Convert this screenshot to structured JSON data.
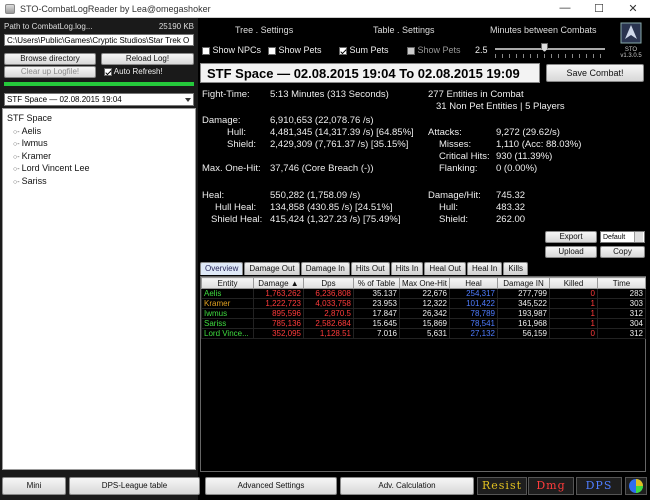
{
  "window": {
    "title": "STO-CombatLogReader by Lea@omegashoker",
    "min": "—",
    "max": "☐",
    "close": "✕"
  },
  "left": {
    "path_label": "Path to CombatLog.log...",
    "size": "25190 KB",
    "path_value": "C:\\Users\\Public\\Games\\Cryptic Studios\\Star Trek O",
    "browse": "Browse directory",
    "reload": "Reload Log!",
    "clear": "Clear up Logfile!",
    "auto_refresh": "Auto Refresh!",
    "combat_select": "STF Space — 02.08.2015 19:04",
    "tree": {
      "root": "STF Space",
      "children": [
        "Aelis",
        "Iwmus",
        "Kramer",
        "Lord Vincent Lee",
        "Sariss"
      ]
    }
  },
  "header": {
    "tree_settings": "Tree . Settings",
    "table_settings": "Table . Settings",
    "minutes": "Minutes between Combats",
    "show_npcs": "Show NPCs",
    "show_pets_tree": "Show Pets",
    "sum_pets": "Sum Pets",
    "show_pets_table": "Show Pets",
    "minutes_value": "2.5",
    "logo_text": "STO",
    "version": "v1.3.0.5"
  },
  "combat": {
    "title": "STF Space — 02.08.2015 19:04 To 02.08.2015 19:09",
    "save": "Save Combat!",
    "fight_time_label": "Fight-Time:",
    "fight_time": "5:13 Minutes (313 Seconds)",
    "entities": "277 Entities in Combat",
    "entities_sub": "31 Non Pet Entities | 5 Players",
    "damage_label": "Damage:",
    "damage": "6,910,653 (22,078.76 /s)",
    "hull_label": "Hull:",
    "hull": "4,481,345 (14,317.39 /s) [64.85%]",
    "shield_label": "Shield:",
    "shield": "2,429,309 (7,761.37 /s) [35.15%]",
    "attacks_label": "Attacks:",
    "attacks": "9,272 (29.62/s)",
    "misses_label": "Misses:",
    "misses": "1,110 (Acc: 88.03%)",
    "crits_label": "Critical Hits:",
    "crits": "930 (11.39%)",
    "flanking_label": "Flanking:",
    "flanking": "0 (0.00%)",
    "maxhit_label": "Max. One-Hit:",
    "maxhit": "37,746 (Core Breach (-))",
    "heal_label": "Heal:",
    "heal": "550,282 (1,758.09 /s)",
    "hullheal_label": "Hull Heal:",
    "hullheal": "134,858 (430.85 /s) [24.51%]",
    "shieldheal_label": "Shield Heal:",
    "shieldheal": "415,424 (1,327.23 /s) [75.49%]",
    "dmghit_label": "Damage/Hit:",
    "dmghit": "745.32",
    "dmghit_hull_label": "Hull:",
    "dmghit_hull": "483.32",
    "dmghit_shield_label": "Shield:",
    "dmghit_shield": "262.00",
    "export": "Export",
    "export_format": "Default",
    "upload": "Upload",
    "copy": "Copy"
  },
  "tabs": [
    "Overview",
    "Damage Out",
    "Damage In",
    "Hits Out",
    "Hits In",
    "Heal Out",
    "Heal In",
    "Kills"
  ],
  "table": {
    "columns": [
      "Entity",
      "Damage ▲",
      "Dps",
      "% of Table",
      "Max One-Hit",
      "Heal",
      "Damage IN",
      "Killed",
      "Time"
    ],
    "rows": [
      {
        "color": "#3fdc3f",
        "cells": [
          "Aelis",
          "1,763,262",
          "6,236,808",
          "35.137",
          "22,676",
          "254,317",
          "277,799",
          "0",
          "283"
        ]
      },
      {
        "color": "#e0a020",
        "cells": [
          "Kramer",
          "1,222,723",
          "4,033,758",
          "23.953",
          "12,322",
          "101,422",
          "345,522",
          "1",
          "303"
        ]
      },
      {
        "color": "#3fdc3f",
        "cells": [
          "Iwmus",
          "895,596",
          "2,870.5",
          "17.847",
          "26,342",
          "78,789",
          "193,987",
          "1",
          "312"
        ]
      },
      {
        "color": "#3fdc3f",
        "cells": [
          "Sariss",
          "785,136",
          "2,582.684",
          "15.645",
          "15,869",
          "78,541",
          "161,968",
          "1",
          "304"
        ]
      },
      {
        "color": "#3fdc3f",
        "cells": [
          "Lord Vince...",
          "352,095",
          "1,128.51",
          "7.016",
          "5,631",
          "27,132",
          "56,159",
          "0",
          "312"
        ]
      }
    ]
  },
  "bottom": {
    "mini": "Mini",
    "dps_league": "DPS-League table",
    "advanced": "Advanced Settings",
    "adv_calc": "Adv. Calculation",
    "resist": "Resist",
    "dmg": "Dmg",
    "dps": "DPS"
  },
  "colors": {
    "name_green": "#3fdc3f",
    "name_orange": "#e0a020",
    "bar_green": "#25c93b",
    "damage_red": "#ff3b3b",
    "heal_blue": "#4f7dff"
  }
}
